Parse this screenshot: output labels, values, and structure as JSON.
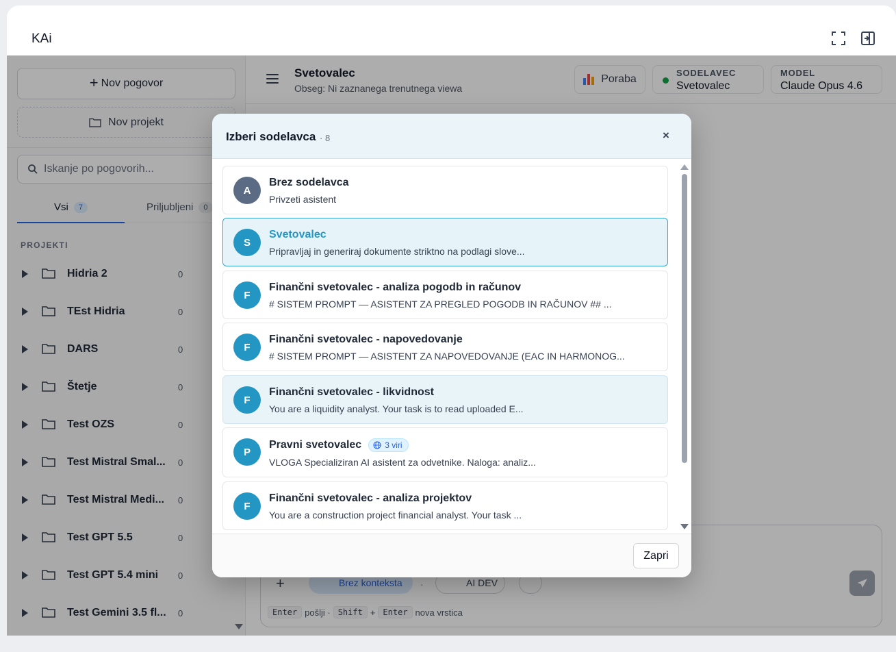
{
  "app": {
    "title": "KAi"
  },
  "sidebar": {
    "new_chat_label": "Nov pogovor",
    "new_project_label": "Nov projekt",
    "search_placeholder": "Iskanje po pogovorih...",
    "tabs": [
      {
        "label": "Vsi",
        "count": "7"
      },
      {
        "label": "Priljubljeni",
        "count": "0"
      }
    ],
    "section_label": "PROJEKTI",
    "projects": [
      {
        "name": "Hidria 2",
        "count": "0"
      },
      {
        "name": "TEst Hidria",
        "count": "0"
      },
      {
        "name": "DARS",
        "count": "0"
      },
      {
        "name": "Štetje",
        "count": "0"
      },
      {
        "name": "Test OZS",
        "count": "0"
      },
      {
        "name": "Test Mistral Smal...",
        "count": "0"
      },
      {
        "name": "Test Mistral Medi...",
        "count": "0"
      },
      {
        "name": "Test GPT 5.5",
        "count": "0"
      },
      {
        "name": "Test GPT 5.4 mini",
        "count": "0"
      },
      {
        "name": "Test Gemini 3.5 fl...",
        "count": "0"
      }
    ]
  },
  "main": {
    "title": "Svetovalec",
    "subtitle": "Obseg: Ni zaznanega trenutnega viewa",
    "usage_label": "Poraba",
    "agent_label": "SODELAVEC",
    "agent_value": "Svetovalec",
    "model_label": "MODEL",
    "model_value": "Claude Opus 4.6"
  },
  "composer": {
    "context_chip": "Brez konteksta",
    "separator": "·",
    "dev_chip": "AI DEV",
    "hint": {
      "key_enter": "Enter",
      "send_text": "pošlji ·",
      "key_shift": "Shift",
      "plus": "+",
      "key_enter2": "Enter",
      "newline_text": "nova vrstica"
    }
  },
  "modal": {
    "title": "Izberi sodelavca",
    "count": "· 8",
    "close_glyph": "×",
    "footer_button": "Zapri",
    "agents": [
      {
        "initial": "A",
        "name": "Brez sodelavca",
        "desc": "Privzeti asistent",
        "state": "normal",
        "avatar": "grey"
      },
      {
        "initial": "S",
        "name": "Svetovalec",
        "desc": "Pripravljaj in generiraj dokumente striktno na podlagi slove...",
        "state": "selected",
        "avatar": "blue"
      },
      {
        "initial": "F",
        "name": "Finančni svetovalec - analiza pogodb in računov",
        "desc": "# SISTEM PROMPT — ASISTENT ZA PREGLED POGODB IN RAČUNOV ## ...",
        "state": "normal",
        "avatar": "blue"
      },
      {
        "initial": "F",
        "name": "Finančni svetovalec - napovedovanje",
        "desc": "# SISTEM PROMPT — ASISTENT ZA NAPOVEDOVANJE (EAC IN HARMONOG...",
        "state": "normal",
        "avatar": "blue"
      },
      {
        "initial": "F",
        "name": "Finančni svetovalec - likvidnost",
        "desc": "You are a liquidity analyst. Your task is to read uploaded E...",
        "state": "hover",
        "avatar": "blue"
      },
      {
        "initial": "P",
        "name": "Pravni svetovalec",
        "desc": "VLOGA Specializiran AI asistent za odvetnike. Naloga: analiz...",
        "state": "normal",
        "avatar": "blue",
        "badge": "3 viri"
      },
      {
        "initial": "F",
        "name": "Finančni svetovalec - analiza projektov",
        "desc": "You are a construction project financial analyst. Your task ...",
        "state": "normal",
        "avatar": "blue"
      }
    ]
  },
  "colors": {
    "accent": "#2563eb",
    "agent_avatar": "#2496c4",
    "selected_text": "#2596c4",
    "status_online": "#16a34a"
  }
}
